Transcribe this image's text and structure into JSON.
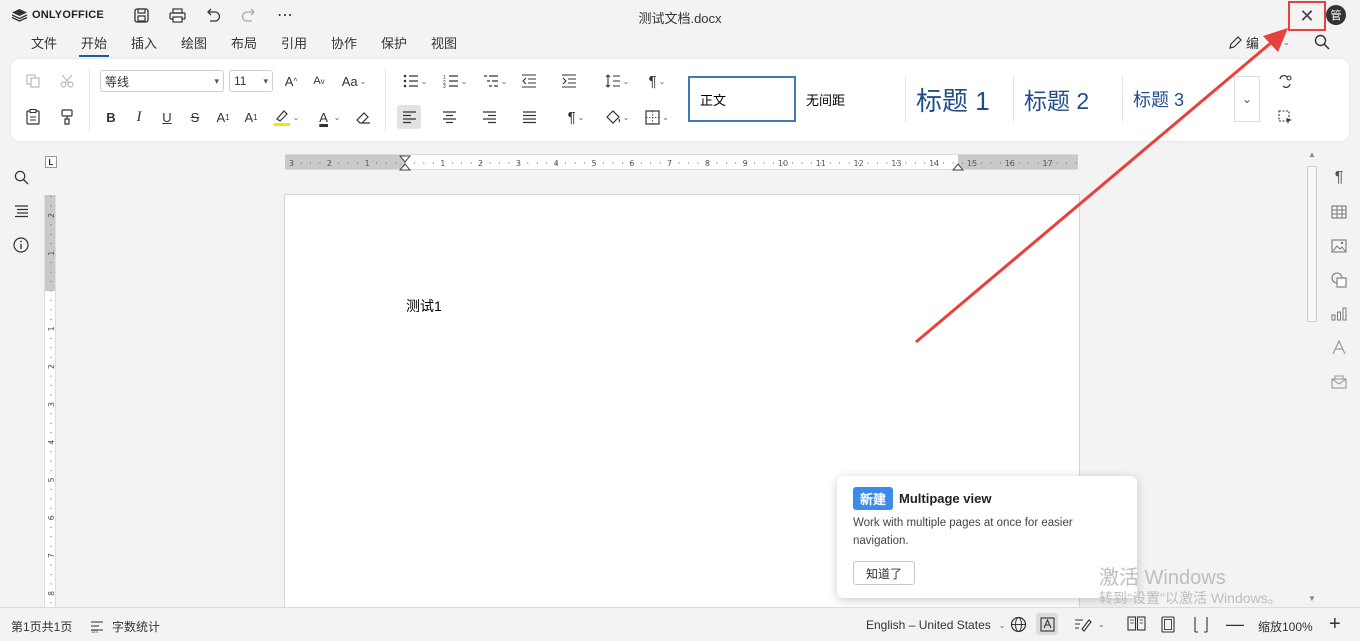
{
  "app": {
    "logo": "ONLYOFFICE",
    "doc_title": "测试文档.docx",
    "avatar": "管"
  },
  "tabs": [
    "文件",
    "开始",
    "插入",
    "绘图",
    "布局",
    "引用",
    "协作",
    "保护",
    "视图"
  ],
  "active_tab": "开始",
  "edit_mode": {
    "label": "编"
  },
  "toolbar": {
    "font_name": "等线",
    "font_size": "11",
    "font_grow": "A",
    "font_shrink": "A",
    "change_case": "Aa",
    "bold": "B",
    "italic": "I",
    "underline": "U",
    "strike": "S",
    "superscript": "A",
    "subscript": "A",
    "font_color_letter": "A",
    "highlight_color": "#f5e400",
    "font_color": "#000000"
  },
  "styles": [
    {
      "label": "正文"
    },
    {
      "label": "无间距"
    },
    {
      "label": "标题 1"
    },
    {
      "label": "标题 2"
    },
    {
      "label": "标题 3"
    }
  ],
  "document": {
    "text": "测试1"
  },
  "ruler": {
    "h_labels": [
      "3",
      "2",
      "1",
      "1",
      "2",
      "3",
      "4",
      "5",
      "6",
      "7",
      "8",
      "9",
      "10",
      "11",
      "12",
      "13",
      "14",
      "15",
      "16",
      "17"
    ],
    "v_labels": [
      "2",
      "1",
      "1",
      "2",
      "3",
      "4",
      "5",
      "6",
      "7",
      "8"
    ]
  },
  "popover": {
    "badge": "新建",
    "title": "Multipage view",
    "description": "Work with multiple pages at once for easier navigation.",
    "button": "知道了"
  },
  "watermark": {
    "line1": "激活 Windows",
    "line2": "转到\"设置\"以激活 Windows。"
  },
  "status": {
    "page_info": "第1页共1页",
    "word_count": "字数统计",
    "language": "English – United States",
    "zoom": "缩放100%"
  },
  "colors": {
    "accent": "#1c5c99",
    "highlight_box": "#e8413c",
    "badge": "#3d8be8"
  }
}
